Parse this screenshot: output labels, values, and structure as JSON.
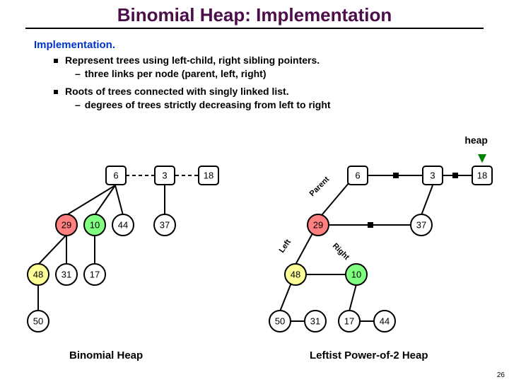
{
  "title": "Binomial Heap:  Implementation",
  "section": "Implementation.",
  "bullet1": "Represent trees using left-child, right sibling pointers.",
  "bullet1sub": "three links per node (parent, left, right)",
  "bullet2": "Roots of trees connected with singly linked list.",
  "bullet2sub": "degrees of trees strictly decreasing from left to right",
  "heap_label": "heap",
  "caption_left": "Binomial Heap",
  "caption_right": "Leftist Power-of-2 Heap",
  "page_num": "26",
  "edge_labels": {
    "parent": "Parent",
    "left": "Left",
    "right": "Right"
  },
  "left_tree": {
    "r": {
      "a": "6",
      "b": "3",
      "c": "18"
    },
    "l1": {
      "a": "29",
      "b": "10",
      "c": "44",
      "d": "37"
    },
    "l2": {
      "a": "48",
      "b": "31",
      "c": "17"
    },
    "l3": {
      "a": "50"
    }
  },
  "right_tree": {
    "r": {
      "a": "6",
      "b": "3",
      "c": "18"
    },
    "l1": {
      "a": "29",
      "b": "37"
    },
    "l2": {
      "a": "48",
      "b": "10"
    },
    "l3": {
      "a": "50",
      "b": "31",
      "c": "17",
      "d": "44"
    }
  }
}
